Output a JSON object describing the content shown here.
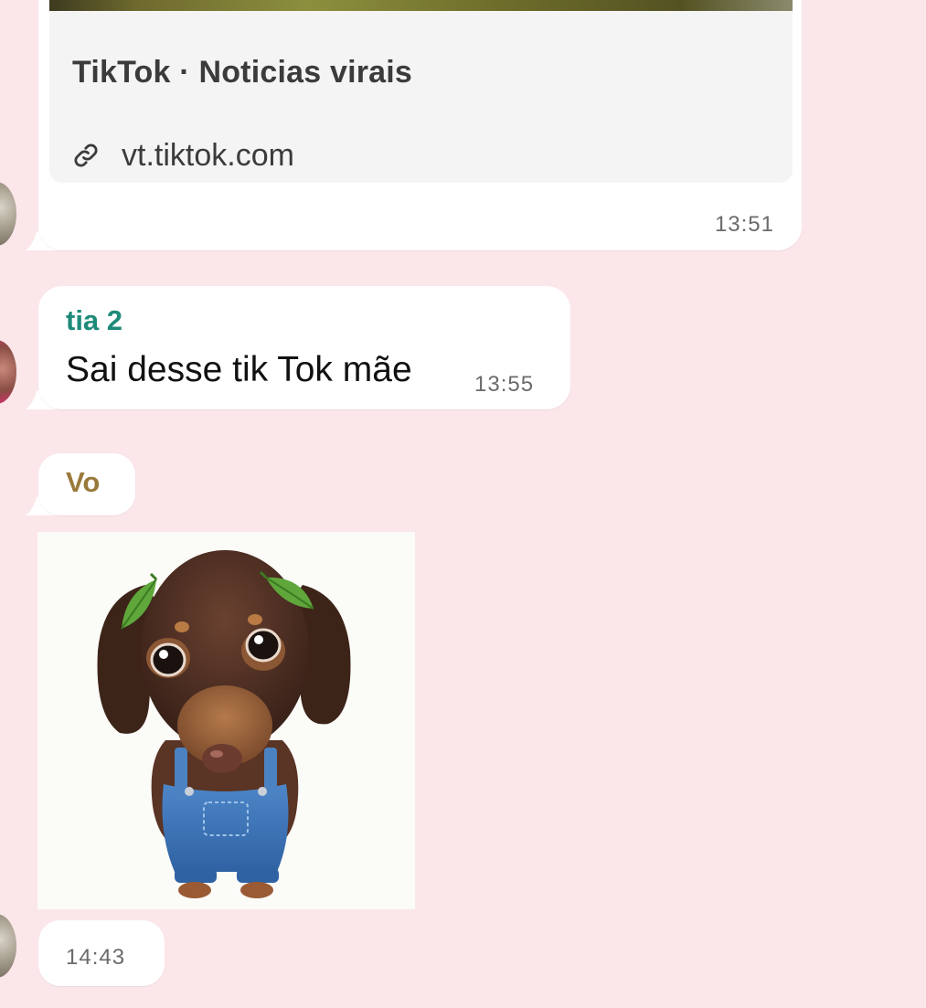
{
  "colors": {
    "background": "#fbe6ea",
    "bubble": "#ffffff",
    "preview_card": "#f4f4f4",
    "sender_tia2": "#1e8a7a",
    "sender_vo": "#9a7a3a",
    "timestamp": "#6b6b6b"
  },
  "messages": [
    {
      "type": "link-preview",
      "preview_title": "TikTok · Noticias virais",
      "link_icon": "link-icon",
      "link_domain": "vt.tiktok.com",
      "time": "13:51"
    },
    {
      "type": "text",
      "sender": "tia 2",
      "text": "Sai desse tik Tok mãe",
      "time": "13:55"
    },
    {
      "type": "sticker",
      "sender": "Vo",
      "sticker": "dachshund-puppy-in-overalls-sticker",
      "time": "14:43"
    }
  ]
}
